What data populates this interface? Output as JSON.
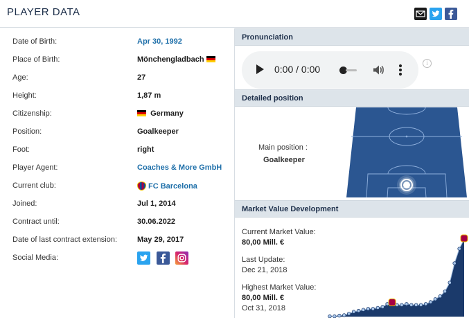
{
  "page": {
    "title": "PLAYER DATA"
  },
  "share": {
    "mail_icon": "mail-icon",
    "twitter_icon": "twitter-icon",
    "facebook_icon": "facebook-icon"
  },
  "player": {
    "rows": [
      {
        "label": "Date of Birth:",
        "value": "Apr 30, 1992"
      },
      {
        "label": "Place of Birth:",
        "value": "Mönchengladbach"
      },
      {
        "label": "Age:",
        "value": "27"
      },
      {
        "label": "Height:",
        "value": "1,87 m"
      },
      {
        "label": "Citizenship:",
        "value": "Germany"
      },
      {
        "label": "Position:",
        "value": "Goalkeeper"
      },
      {
        "label": "Foot:",
        "value": "right"
      },
      {
        "label": "Player Agent:",
        "value": "Coaches & More GmbH"
      },
      {
        "label": "Current club:",
        "value": "FC Barcelona"
      },
      {
        "label": "Joined:",
        "value": "Jul 1, 2014"
      },
      {
        "label": "Contract until:",
        "value": "30.06.2022"
      },
      {
        "label": "Date of last contract extension:",
        "value": "May 29, 2017"
      },
      {
        "label": "Social Media:",
        "value": ""
      }
    ]
  },
  "pronunciation": {
    "heading": "Pronunciation",
    "time_display": "0:00 / 0:00"
  },
  "position": {
    "heading": "Detailed position",
    "main_label": "Main position :",
    "main_value": "Goalkeeper"
  },
  "market_value": {
    "heading": "Market Value Development",
    "current_label": "Current Market Value:",
    "current_value": "80,00 Mill. €",
    "update_label": "Last Update:",
    "update_value": "Dec 21, 2018",
    "highest_label": "Highest Market Value:",
    "highest_value": "80,00 Mill. €",
    "highest_date": "Oct 31, 2018"
  },
  "colors": {
    "accent": "#1e6fa9",
    "chart_fill": "#1b3a6b",
    "pitch": "#2b5691"
  },
  "chart_data": {
    "type": "area",
    "x": [
      0,
      1,
      2,
      3,
      4,
      5,
      6,
      7,
      8,
      9,
      10,
      11,
      12,
      13,
      14,
      15,
      16,
      17,
      18,
      19,
      20,
      21,
      22,
      23,
      24,
      25,
      26,
      27,
      28
    ],
    "values": [
      0.3,
      0.3,
      1,
      1.5,
      3,
      5,
      6,
      7,
      8,
      8,
      9,
      10,
      13,
      14,
      12,
      12,
      13,
      12,
      12,
      12,
      13,
      15,
      18,
      21,
      26,
      35,
      55,
      70,
      80
    ],
    "ylim": [
      0,
      80
    ]
  }
}
